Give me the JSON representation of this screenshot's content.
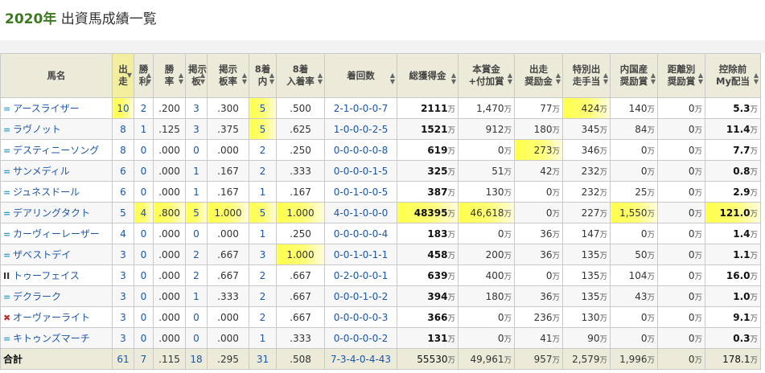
{
  "header": {
    "year": "2020年",
    "title": "出資馬成績一覧"
  },
  "columns": [
    "馬名",
    "出走",
    "勝利",
    "勝率",
    "掲示板",
    "掲示板率",
    "8着内",
    "8着入着率",
    "着回数",
    "総獲得金",
    "本賞金+付加賞",
    "出走奨励金",
    "特別出走手当",
    "内国産奨励賞",
    "距離別奨励賞",
    "控除前My配当"
  ],
  "columns_display": [
    [
      "馬名"
    ],
    [
      "出",
      "走"
    ],
    [
      "勝",
      "利"
    ],
    [
      "勝",
      "率"
    ],
    [
      "掲示",
      "板"
    ],
    [
      "掲示",
      "板率"
    ],
    [
      "8着",
      "内"
    ],
    [
      "8着",
      "入着率"
    ],
    [
      "着回数"
    ],
    [
      "総獲得金"
    ],
    [
      "本賞金",
      "+付加賞"
    ],
    [
      "出走",
      "奨励金"
    ],
    [
      "特別出",
      "走手当"
    ],
    [
      "内国産",
      "奨励賞"
    ],
    [
      "距離別",
      "奨励賞"
    ],
    [
      "控除前",
      "My配当"
    ]
  ],
  "unit": "万",
  "rows": [
    {
      "mark": "blue",
      "name": "アースライザー",
      "starts": "10",
      "wins": "2",
      "win_rate": ".200",
      "board": "3",
      "board_rate": ".300",
      "top8": "5",
      "top8_rate": ".500",
      "record": "2-1-0-0-0-7",
      "total": "2111",
      "prize": "1,470",
      "start_bonus": "77",
      "special": "424",
      "domestic": "140",
      "distance": "0",
      "dividend": "5.3",
      "hl": [
        "starts",
        "top8",
        "special"
      ]
    },
    {
      "mark": "blue",
      "name": "ラヴノット",
      "starts": "8",
      "wins": "1",
      "win_rate": ".125",
      "board": "3",
      "board_rate": ".375",
      "top8": "5",
      "top8_rate": ".625",
      "record": "1-0-0-0-2-5",
      "total": "1521",
      "prize": "912",
      "start_bonus": "180",
      "special": "345",
      "domestic": "84",
      "distance": "0",
      "dividend": "11.4",
      "hl": [
        "top8"
      ]
    },
    {
      "mark": "blue",
      "name": "デスティニーソング",
      "starts": "8",
      "wins": "0",
      "win_rate": ".000",
      "board": "0",
      "board_rate": ".000",
      "top8": "2",
      "top8_rate": ".250",
      "record": "0-0-0-0-0-8",
      "total": "619",
      "prize": "0",
      "start_bonus": "273",
      "special": "346",
      "domestic": "0",
      "distance": "0",
      "dividend": "7.7",
      "hl": [
        "start_bonus"
      ]
    },
    {
      "mark": "blue",
      "name": "サンメディル",
      "starts": "6",
      "wins": "0",
      "win_rate": ".000",
      "board": "1",
      "board_rate": ".167",
      "top8": "2",
      "top8_rate": ".333",
      "record": "0-0-0-0-1-5",
      "total": "325",
      "prize": "51",
      "start_bonus": "42",
      "special": "232",
      "domestic": "0",
      "distance": "0",
      "dividend": "0.8",
      "hl": []
    },
    {
      "mark": "blue",
      "name": "ジュネスドール",
      "starts": "6",
      "wins": "0",
      "win_rate": ".000",
      "board": "1",
      "board_rate": ".167",
      "top8": "1",
      "top8_rate": ".167",
      "record": "0-0-1-0-0-5",
      "total": "387",
      "prize": "130",
      "start_bonus": "0",
      "special": "232",
      "domestic": "25",
      "distance": "0",
      "dividend": "2.9",
      "hl": []
    },
    {
      "mark": "blue",
      "name": "デアリングタクト",
      "starts": "5",
      "wins": "4",
      "win_rate": ".800",
      "board": "5",
      "board_rate": "1.000",
      "top8": "5",
      "top8_rate": "1.000",
      "record": "4-0-1-0-0-0",
      "total": "48395",
      "prize": "46,618",
      "start_bonus": "0",
      "special": "227",
      "domestic": "1,550",
      "distance": "0",
      "dividend": "121.0",
      "hl": [
        "wins",
        "win_rate",
        "board",
        "board_rate",
        "top8",
        "top8_rate",
        "total",
        "prize",
        "domestic",
        "dividend"
      ]
    },
    {
      "mark": "blue",
      "name": "カーヴィーレーザー",
      "starts": "4",
      "wins": "0",
      "win_rate": ".000",
      "board": "0",
      "board_rate": ".000",
      "top8": "1",
      "top8_rate": ".250",
      "record": "0-0-0-0-0-4",
      "total": "183",
      "prize": "0",
      "start_bonus": "36",
      "special": "147",
      "domestic": "0",
      "distance": "0",
      "dividend": "1.4",
      "hl": []
    },
    {
      "mark": "blue",
      "name": "ザベストデイ",
      "starts": "3",
      "wins": "0",
      "win_rate": ".000",
      "board": "2",
      "board_rate": ".667",
      "top8": "3",
      "top8_rate": "1.000",
      "record": "0-0-1-0-1-1",
      "total": "458",
      "prize": "200",
      "start_bonus": "36",
      "special": "135",
      "domestic": "50",
      "distance": "0",
      "dividend": "1.1",
      "hl": [
        "top8_rate"
      ]
    },
    {
      "mark": "yellow",
      "name": "トゥーフェイス",
      "starts": "3",
      "wins": "0",
      "win_rate": ".000",
      "board": "2",
      "board_rate": ".667",
      "top8": "2",
      "top8_rate": ".667",
      "record": "0-2-0-0-0-1",
      "total": "639",
      "prize": "400",
      "start_bonus": "0",
      "special": "135",
      "domestic": "104",
      "distance": "0",
      "dividend": "16.0",
      "hl": []
    },
    {
      "mark": "blue",
      "name": "デクラーク",
      "starts": "3",
      "wins": "0",
      "win_rate": ".000",
      "board": "1",
      "board_rate": ".333",
      "top8": "2",
      "top8_rate": ".667",
      "record": "0-0-0-1-0-2",
      "total": "394",
      "prize": "180",
      "start_bonus": "36",
      "special": "135",
      "domestic": "43",
      "distance": "0",
      "dividend": "1.0",
      "hl": []
    },
    {
      "mark": "red",
      "name": "オーヴァーライト",
      "starts": "3",
      "wins": "0",
      "win_rate": ".000",
      "board": "0",
      "board_rate": ".000",
      "top8": "2",
      "top8_rate": ".667",
      "record": "0-0-0-0-0-3",
      "total": "366",
      "prize": "0",
      "start_bonus": "236",
      "special": "130",
      "domestic": "0",
      "distance": "0",
      "dividend": "9.1",
      "hl": []
    },
    {
      "mark": "blue",
      "name": "キトゥンズマーチ",
      "starts": "3",
      "wins": "0",
      "win_rate": ".000",
      "board": "0",
      "board_rate": ".000",
      "top8": "1",
      "top8_rate": ".333",
      "record": "0-0-0-0-0-2",
      "total": "131",
      "prize": "0",
      "start_bonus": "41",
      "special": "90",
      "domestic": "0",
      "distance": "0",
      "dividend": "0.3",
      "hl": []
    }
  ],
  "total": {
    "label": "合計",
    "starts": "61",
    "wins": "7",
    "win_rate": ".115",
    "board": "18",
    "board_rate": ".295",
    "top8": "31",
    "top8_rate": ".508",
    "record": "7-3-4-0-4-43",
    "total": "55530",
    "prize": "49,961",
    "start_bonus": "957",
    "special": "2,579",
    "domestic": "1,996",
    "distance": "0",
    "dividend": "178.1"
  },
  "marks": {
    "blue": "=",
    "yellow": "II",
    "red": "✖"
  },
  "colors": {
    "highlight": "#ffff4a",
    "header_bg": "#ecebd9",
    "link": "#1c56a8",
    "title_year": "#3b7a1f"
  }
}
